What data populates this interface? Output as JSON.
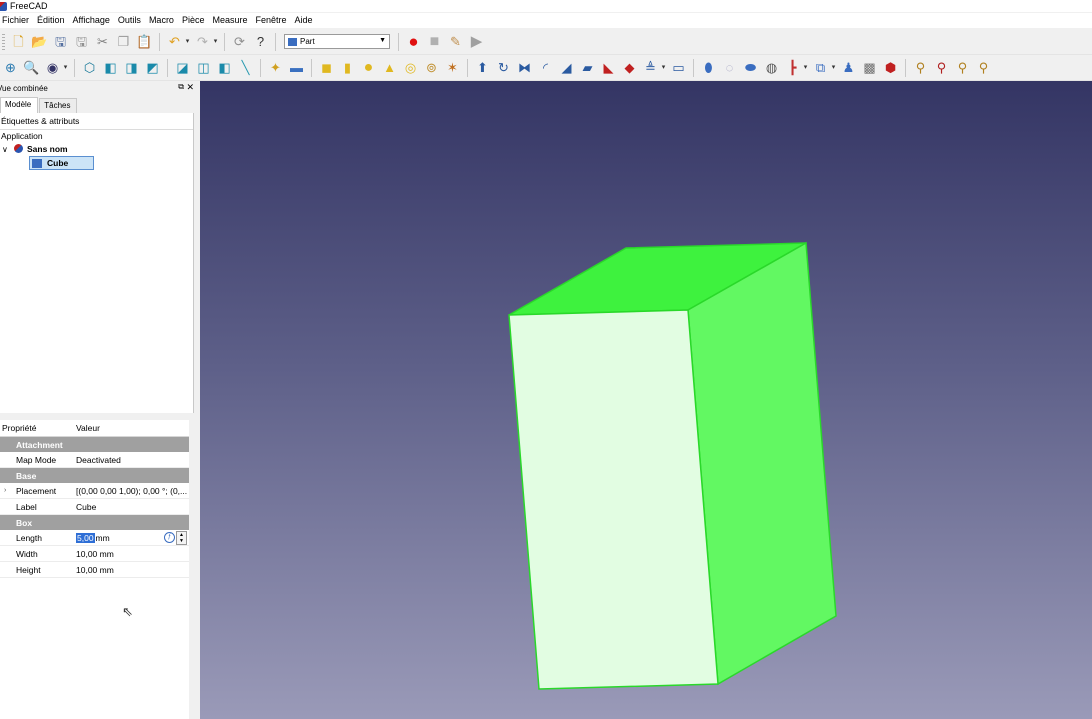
{
  "window": {
    "title": "FreeCAD"
  },
  "menu": [
    "Fichier",
    "Édition",
    "Affichage",
    "Outils",
    "Macro",
    "Pièce",
    "Measure",
    "Fenêtre",
    "Aide"
  ],
  "workbench": {
    "selected": "Part"
  },
  "combo_view": {
    "title": "Vue combinée",
    "tabs": [
      "Modèle",
      "Tâches"
    ],
    "tree_header": "Étiquettes & attributs",
    "application_label": "Application",
    "document": "Sans nom",
    "object": "Cube"
  },
  "properties": {
    "header": {
      "property": "Propriété",
      "value": "Valeur"
    },
    "rows": [
      {
        "kind": "group",
        "name": "Attachment"
      },
      {
        "kind": "prop",
        "name": "Map Mode",
        "value": "Deactivated"
      },
      {
        "kind": "group",
        "name": "Base"
      },
      {
        "kind": "prop",
        "name": "Placement",
        "value": "[(0,00 0,00 1,00); 0,00 °; (0,...",
        "expandable": true
      },
      {
        "kind": "prop",
        "name": "Label",
        "value": "Cube"
      },
      {
        "kind": "group",
        "name": "Box"
      },
      {
        "kind": "edit",
        "name": "Length",
        "value": "5,00",
        "unit": "mm"
      },
      {
        "kind": "prop",
        "name": "Width",
        "value": "10,00 mm"
      },
      {
        "kind": "prop",
        "name": "Height",
        "value": "10,00 mm"
      }
    ]
  },
  "colors": {
    "cube_top": "#3ef23e",
    "cube_right": "#62f862",
    "cube_front": "#e2fde2",
    "cube_edge": "#2ad82a",
    "selection": "#cce4f7",
    "viewport_top": "#343564",
    "viewport_bottom": "#9a9ab8"
  }
}
